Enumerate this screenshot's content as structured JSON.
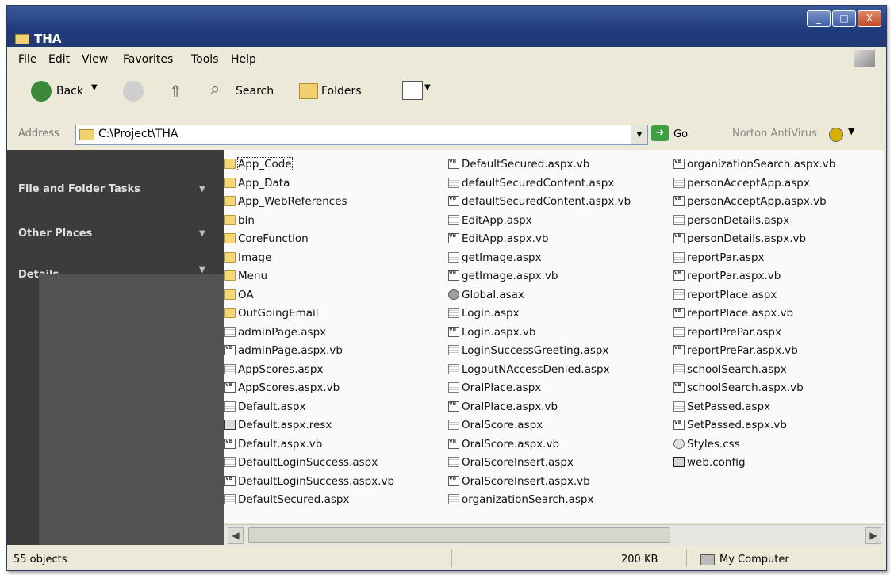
{
  "window": {
    "title": "THA",
    "min_label": "_",
    "max_label": "□",
    "close_label": "X"
  },
  "menu": {
    "items": [
      "File",
      "Edit",
      "View",
      "Favorites",
      "Tools",
      "Help"
    ]
  },
  "toolbar": {
    "back_label": "Back",
    "search_label": "Search",
    "folders_label": "Folders"
  },
  "address": {
    "label": "Address",
    "value": "C:\\Project\\THA",
    "go_label": "Go",
    "norton_label": "Norton AntiVirus"
  },
  "tasks": {
    "file_folder_tasks": "File and Folder Tasks",
    "other_places": "Other Places",
    "details": "Details"
  },
  "files": {
    "columns": [
      [
        {
          "name": "App_Code",
          "type": "folder"
        },
        {
          "name": "App_Data",
          "type": "folder"
        },
        {
          "name": "App_WebReferences",
          "type": "folder"
        },
        {
          "name": "bin",
          "type": "folder"
        },
        {
          "name": "CoreFunction",
          "type": "folder"
        },
        {
          "name": "Image",
          "type": "folder"
        },
        {
          "name": "Menu",
          "type": "folder"
        },
        {
          "name": "OA",
          "type": "folder"
        },
        {
          "name": "OutGoingEmail",
          "type": "folder"
        },
        {
          "name": "adminPage.aspx",
          "type": "aspx"
        },
        {
          "name": "adminPage.aspx.vb",
          "type": "vb"
        },
        {
          "name": "AppScores.aspx",
          "type": "aspx"
        },
        {
          "name": "AppScores.aspx.vb",
          "type": "vb"
        },
        {
          "name": "Default.aspx",
          "type": "aspx"
        },
        {
          "name": "Default.aspx.resx",
          "type": "resx"
        },
        {
          "name": "Default.aspx.vb",
          "type": "vb"
        },
        {
          "name": "DefaultLoginSuccess.aspx",
          "type": "aspx"
        },
        {
          "name": "DefaultLoginSuccess.aspx.vb",
          "type": "vb"
        },
        {
          "name": "DefaultSecured.aspx",
          "type": "aspx"
        }
      ],
      [
        {
          "name": "DefaultSecured.aspx.vb",
          "type": "vb"
        },
        {
          "name": "defaultSecuredContent.aspx",
          "type": "aspx"
        },
        {
          "name": "defaultSecuredContent.aspx.vb",
          "type": "vb"
        },
        {
          "name": "EditApp.aspx",
          "type": "aspx"
        },
        {
          "name": "EditApp.aspx.vb",
          "type": "vb"
        },
        {
          "name": "getImage.aspx",
          "type": "aspx"
        },
        {
          "name": "getImage.aspx.vb",
          "type": "vb"
        },
        {
          "name": "Global.asax",
          "type": "asax"
        },
        {
          "name": "Login.aspx",
          "type": "aspx"
        },
        {
          "name": "Login.aspx.vb",
          "type": "vb"
        },
        {
          "name": "LoginSuccessGreeting.aspx",
          "type": "aspx"
        },
        {
          "name": "LogoutNAccessDenied.aspx",
          "type": "aspx"
        },
        {
          "name": "OralPlace.aspx",
          "type": "aspx"
        },
        {
          "name": "OralPlace.aspx.vb",
          "type": "vb"
        },
        {
          "name": "OralScore.aspx",
          "type": "aspx"
        },
        {
          "name": "OralScore.aspx.vb",
          "type": "vb"
        },
        {
          "name": "OralScoreInsert.aspx",
          "type": "aspx"
        },
        {
          "name": "OralScoreInsert.aspx.vb",
          "type": "vb"
        },
        {
          "name": "organizationSearch.aspx",
          "type": "aspx"
        }
      ],
      [
        {
          "name": "organizationSearch.aspx.vb",
          "type": "vb"
        },
        {
          "name": "personAcceptApp.aspx",
          "type": "aspx"
        },
        {
          "name": "personAcceptApp.aspx.vb",
          "type": "vb"
        },
        {
          "name": "personDetails.aspx",
          "type": "aspx"
        },
        {
          "name": "personDetails.aspx.vb",
          "type": "vb"
        },
        {
          "name": "reportPar.aspx",
          "type": "aspx"
        },
        {
          "name": "reportPar.aspx.vb",
          "type": "vb"
        },
        {
          "name": "reportPlace.aspx",
          "type": "aspx"
        },
        {
          "name": "reportPlace.aspx.vb",
          "type": "vb"
        },
        {
          "name": "reportPrePar.aspx",
          "type": "aspx"
        },
        {
          "name": "reportPrePar.aspx.vb",
          "type": "vb"
        },
        {
          "name": "schoolSearch.aspx",
          "type": "aspx"
        },
        {
          "name": "schoolSearch.aspx.vb",
          "type": "vb"
        },
        {
          "name": "SetPassed.aspx",
          "type": "aspx"
        },
        {
          "name": "SetPassed.aspx.vb",
          "type": "vb"
        },
        {
          "name": "Styles.css",
          "type": "css"
        },
        {
          "name": "web.config",
          "type": "config"
        }
      ]
    ]
  },
  "status": {
    "objects": "55 objects",
    "size": "200 KB",
    "location": "My Computer"
  }
}
